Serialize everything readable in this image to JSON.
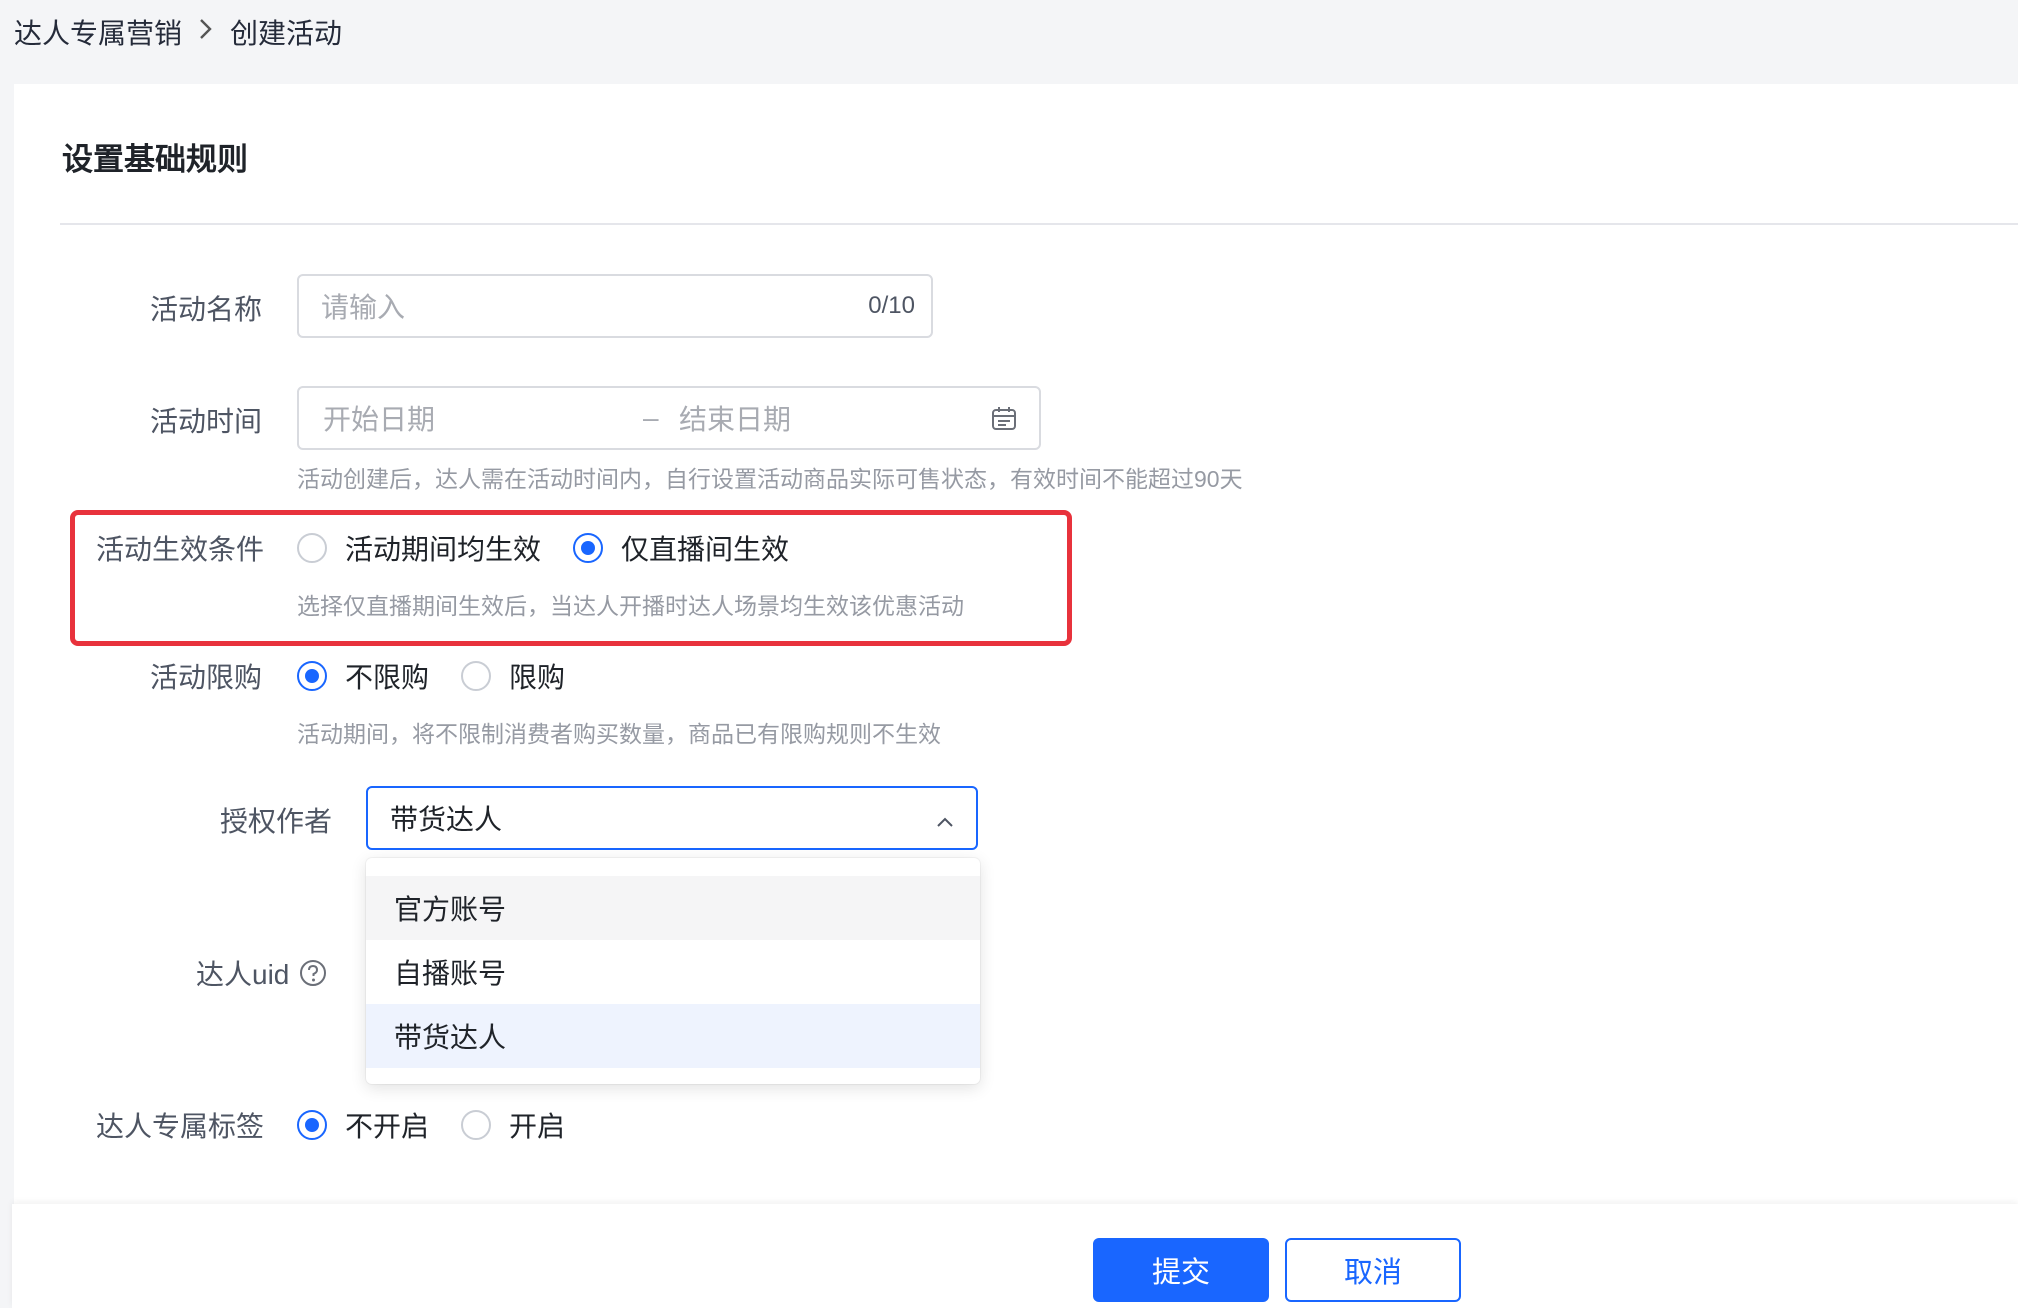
{
  "breadcrumb": {
    "parent": "达人专属营销",
    "current": "创建活动"
  },
  "section_title": "设置基础规则",
  "activity_name": {
    "label": "活动名称",
    "placeholder": "请输入",
    "counter": "0/10"
  },
  "activity_time": {
    "label": "活动时间",
    "start_placeholder": "开始日期",
    "range_sep": "–",
    "end_placeholder": "结束日期",
    "hint": "活动创建后，达人需在活动时间内，自行设置活动商品实际可售状态，有效时间不能超过90天"
  },
  "effect_condition": {
    "label": "活动生效条件",
    "options": [
      "活动期间均生效",
      "仅直播间生效"
    ],
    "selected": "仅直播间生效",
    "hint": "选择仅直播期间生效后，当达人开播时达人场景均生效该优惠活动"
  },
  "purchase_limit": {
    "label": "活动限购",
    "options": [
      "不限购",
      "限购"
    ],
    "selected": "不限购",
    "hint": "活动期间，将不限制消费者购买数量，商品已有限购规则不生效"
  },
  "author": {
    "label": "授权作者",
    "value": "带货达人",
    "options": [
      "官方账号",
      "自播账号",
      "带货达人"
    ]
  },
  "uid": {
    "label": "达人uid"
  },
  "exclusive_tag": {
    "label": "达人专属标签",
    "options": [
      "不开启",
      "开启"
    ],
    "selected": "不开启"
  },
  "footer": {
    "submit": "提交",
    "cancel": "取消"
  },
  "colors": {
    "primary": "#1966ff",
    "highlight": "#e8323c"
  }
}
